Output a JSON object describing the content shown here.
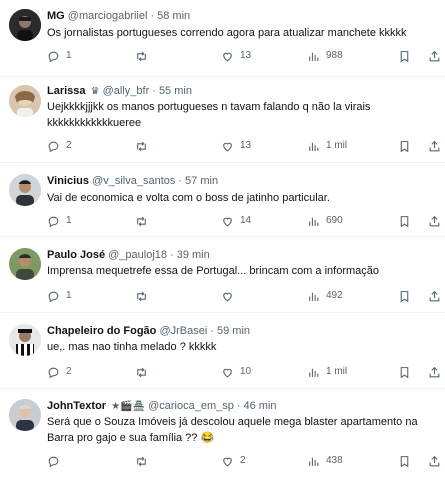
{
  "tweets": [
    {
      "name": "MG",
      "badge": "",
      "handle": "@marciogabriiel",
      "time": "58 min",
      "text": "Os jornalistas portugueses correndo agora para atualizar manchete kkkkk",
      "replies": "1",
      "retweets": "",
      "likes": "13",
      "views": "988",
      "avatar_color": "#2b2b2b"
    },
    {
      "name": "Larissa",
      "badge": "♛",
      "handle": "@ally_bfr",
      "time": "55 min",
      "text": "Uejkkkkjjjkk os manos portugueses n tavam falando q não la virais kkkkkkkkkkkkueree",
      "replies": "2",
      "retweets": "",
      "likes": "13",
      "views": "1 mil",
      "avatar_color": "#c9b49a"
    },
    {
      "name": "Vinicius",
      "badge": "",
      "handle": "@v_silva_santos",
      "time": "57 min",
      "text": "Vai de economica e volta com o boss de jatinho particular.",
      "replies": "1",
      "retweets": "",
      "likes": "14",
      "views": "690",
      "avatar_color": "#3a3f47"
    },
    {
      "name": "Paulo José",
      "badge": "",
      "handle": "@_pauloj18",
      "time": "39 min",
      "text": "Imprensa mequetrefe essa de Portugal... brincam com a informação",
      "replies": "1",
      "retweets": "",
      "likes": "",
      "views": "492",
      "avatar_color": "#6b8a55"
    },
    {
      "name": "Chapeleiro do Fogão",
      "badge": "",
      "handle": "@JrBasei",
      "time": "59 min",
      "text": "ue,. mas nao tinha melado ? kkkkk",
      "replies": "2",
      "retweets": "",
      "likes": "10",
      "views": "1 mil",
      "avatar_color": "#1d1d1d"
    },
    {
      "name": "JohnTextor",
      "badge": "★🎬🏯",
      "handle": "@carioca_em_sp",
      "time": "46 min",
      "text": "Será que o Souza Imóveis já descolou aquele mega blaster apartamento na Barra pro gajo e sua família ?? 😂",
      "replies": "",
      "retweets": "",
      "likes": "2",
      "views": "438",
      "avatar_color": "#b8c0c8"
    }
  ],
  "dot": "·",
  "colors": {
    "text": "#0f1419",
    "secondary": "#536471",
    "divider": "#eff3f4"
  },
  "icons": [
    "reply-icon",
    "retweet-icon",
    "like-icon",
    "views-icon",
    "bookmark-icon",
    "share-icon"
  ]
}
